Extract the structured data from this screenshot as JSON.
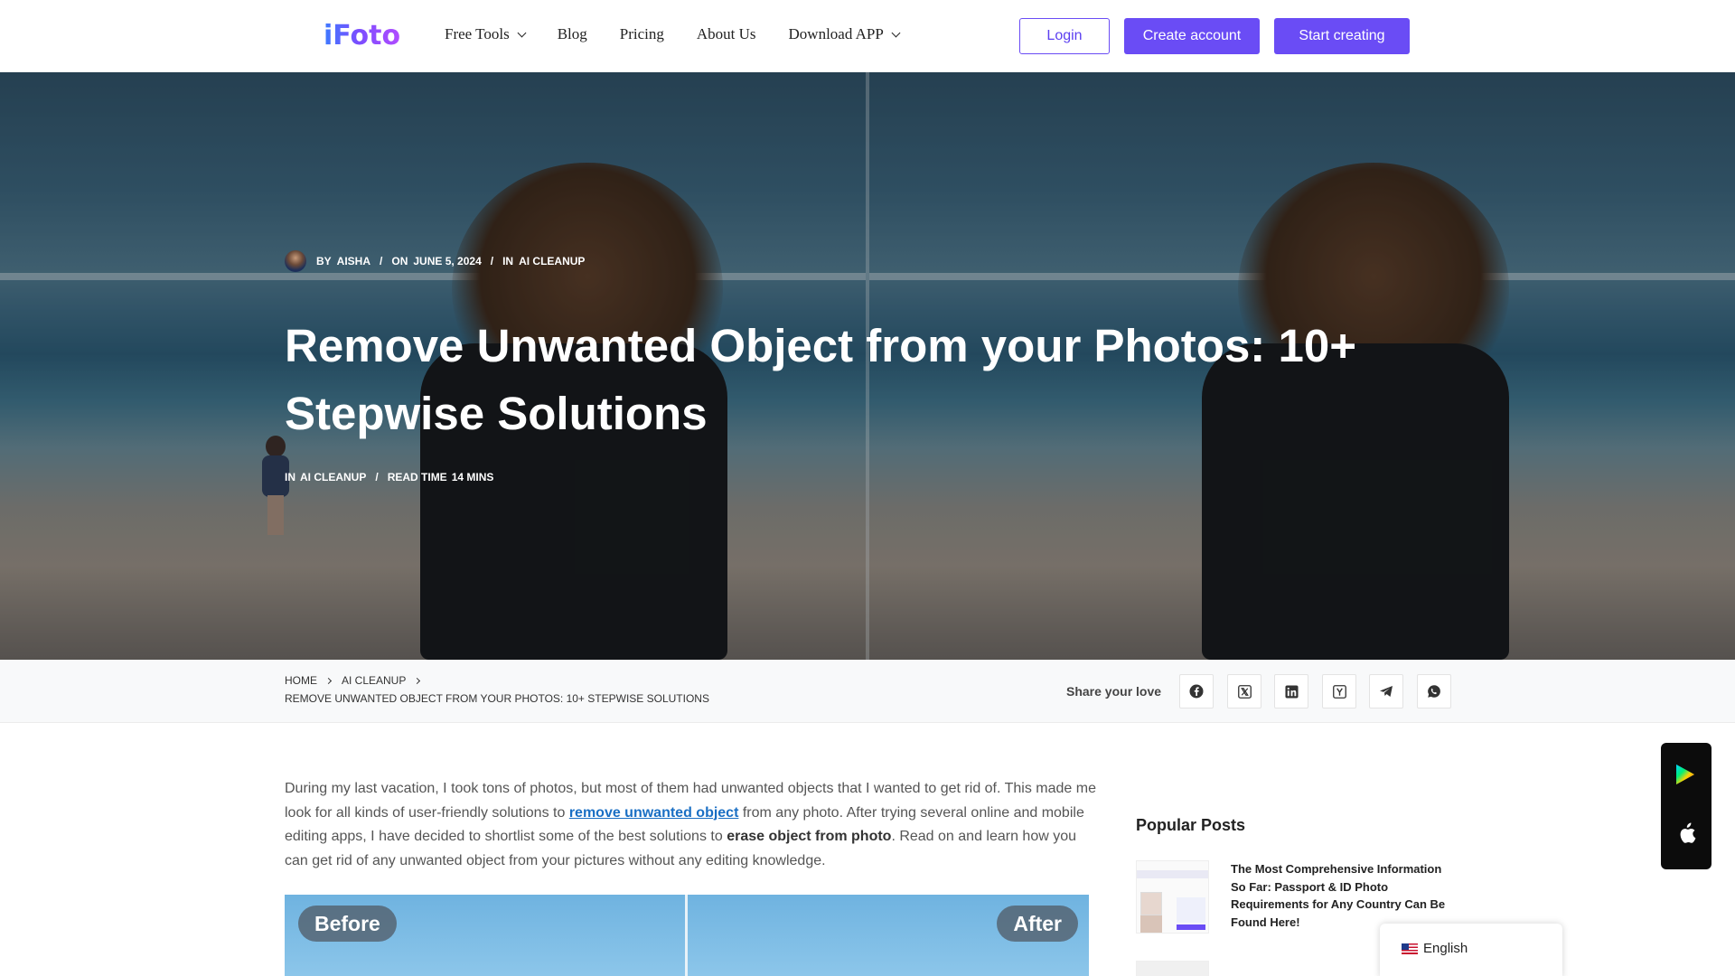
{
  "header": {
    "logo": "iFoto",
    "nav": [
      {
        "label": "Free Tools",
        "dropdown": true
      },
      {
        "label": "Blog",
        "dropdown": false
      },
      {
        "label": "Pricing",
        "dropdown": false
      },
      {
        "label": "About Us",
        "dropdown": false
      },
      {
        "label": "Download APP",
        "dropdown": true
      }
    ],
    "login": "Login",
    "create_account": "Create account",
    "start_creating": "Start creating"
  },
  "hero": {
    "meta": {
      "by": "By",
      "author": "Aisha",
      "on": "On",
      "date": "June 5, 2024",
      "in": "In",
      "category": "AI Cleanup"
    },
    "title": "Remove Unwanted Object from your Photos: 10+ Stepwise Solutions",
    "meta2": {
      "in": "In",
      "category": "AI Cleanup",
      "read_time_label": "Read time",
      "read_time": "14 mins"
    }
  },
  "breadcrumb": {
    "home": "Home",
    "category": "AI Cleanup",
    "current": "Remove Unwanted Object from your Photos: 10+ Stepwise Solutions"
  },
  "share": {
    "label": "Share your love",
    "icons": [
      "facebook-icon",
      "x-icon",
      "linkedin-icon",
      "hacker-news-icon",
      "telegram-icon",
      "whatsapp-icon"
    ]
  },
  "article": {
    "intro_1": "During my last vacation, I took tons of photos, but most of them had unwanted objects that I wanted to get rid of. This made me look for all kinds of user-friendly solutions to ",
    "intro_link": "remove unwanted object",
    "intro_2": " from any photo. After trying several online and mobile editing apps, I have decided to shortlist some of the best solutions to ",
    "intro_bold": "erase object from photo",
    "intro_3": ". Read on and learn how you can get rid of any unwanted object from your pictures without any editing knowledge.",
    "before_label": "Before",
    "after_label": "After"
  },
  "sidebar": {
    "popular_title": "Popular Posts",
    "posts": [
      {
        "title": "The Most Comprehensive Information So Far: Passport & ID Photo Requirements for Any Country Can Be Found Here!"
      }
    ]
  },
  "language": {
    "label": "English"
  },
  "colors": {
    "accent": "#6a4cf5",
    "link": "#1a6fc4"
  }
}
